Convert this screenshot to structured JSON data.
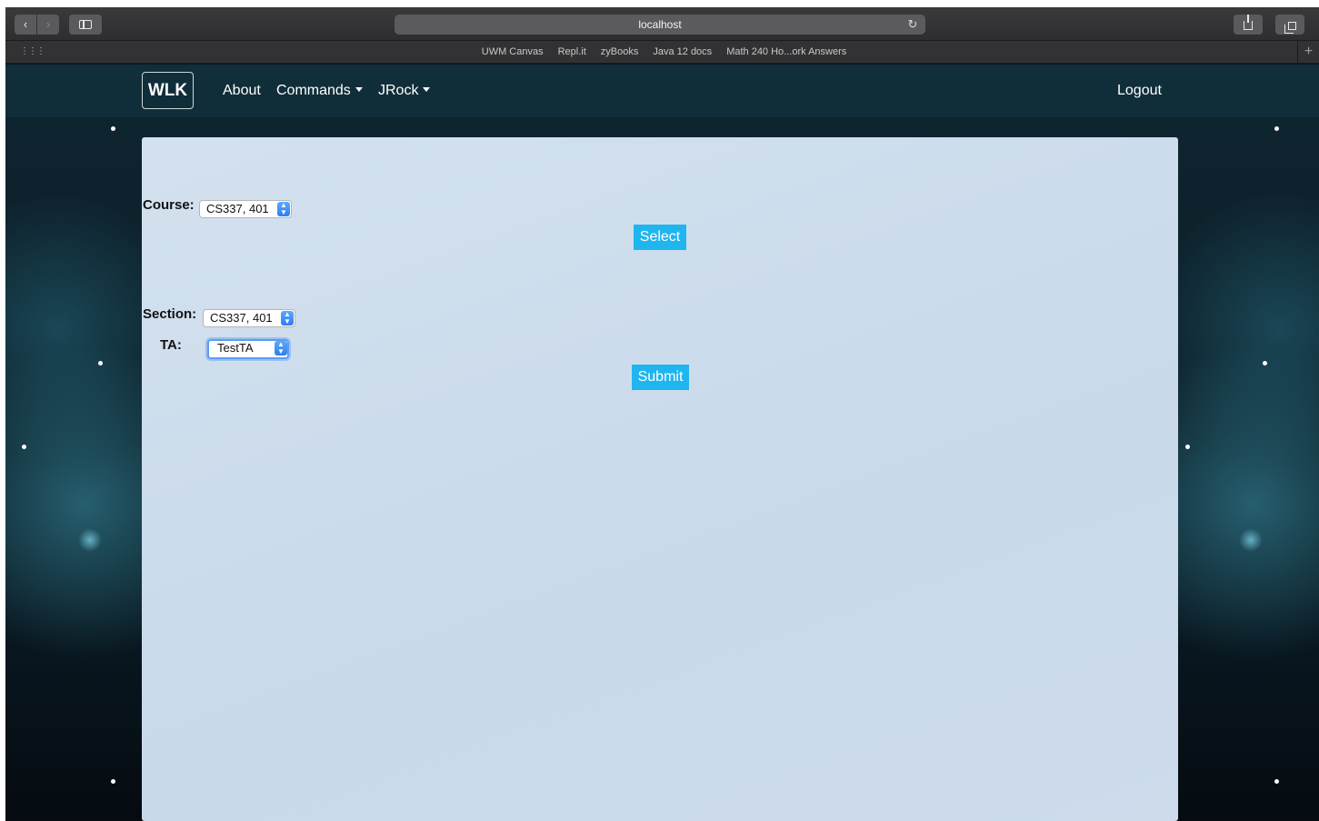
{
  "browser": {
    "url": "localhost",
    "bookmarks": [
      "UWM Canvas",
      "Repl.it",
      "zyBooks",
      "Java 12 docs",
      "Math 240 Ho...ork Answers"
    ]
  },
  "navbar": {
    "brand": "WLK",
    "about": "About",
    "commands": "Commands",
    "user": "JRock",
    "logout": "Logout"
  },
  "form": {
    "course_label": "Course:",
    "course_value": "CS337, 401",
    "select_button": "Select",
    "section_label": "Section:",
    "section_value": "CS337, 401",
    "ta_label": "TA:",
    "ta_value": "TestTA",
    "submit_button": "Submit"
  },
  "colors": {
    "navbar_bg": "#10303c",
    "panel_bg": "#cddbeb",
    "button_bg": "#1fb6f0",
    "stepper_blue": "#2e7ef0"
  }
}
